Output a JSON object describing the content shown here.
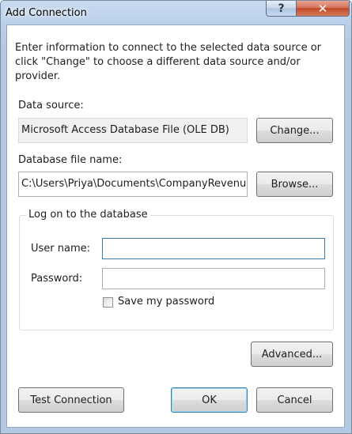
{
  "window": {
    "title": "Add Connection",
    "help_glyph": "?",
    "close_glyph": "✕"
  },
  "intro_text": "Enter information to connect to the selected data source or click \"Change\" to choose a different data source and/or provider.",
  "data_source": {
    "label": "Data source:",
    "value": "Microsoft Access Database File (OLE DB)",
    "change_button": "Change..."
  },
  "database_file": {
    "label": "Database file name:",
    "value": "C:\\Users\\Priya\\Documents\\CompanyRevenu",
    "browse_button": "Browse..."
  },
  "logon": {
    "legend": "Log on to the database",
    "user_label": "User name:",
    "user_value": "",
    "password_label": "Password:",
    "password_value": "",
    "save_password_label": "Save my password",
    "save_password_checked": false
  },
  "advanced_button": "Advanced...",
  "footer": {
    "test_button": "Test Connection",
    "ok_button": "OK",
    "cancel_button": "Cancel"
  }
}
